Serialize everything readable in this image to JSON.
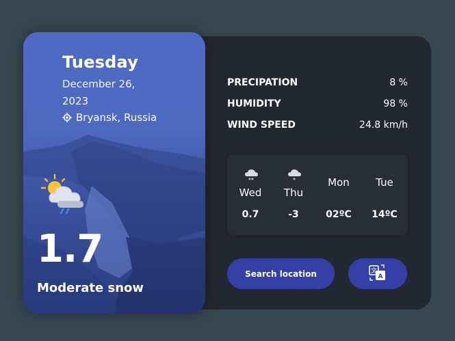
{
  "card": {
    "day": "Tuesday",
    "date": "December 26, 2023",
    "location": "Bryansk, Russia",
    "temperature": "1.7",
    "condition": "Moderate snow",
    "weather_icon": "sun-cloud-rain-icon"
  },
  "stats": [
    {
      "label": "PRECIPATION",
      "value": "8 %"
    },
    {
      "label": "HUMIDITY",
      "value": "98 %"
    },
    {
      "label": "WIND SPEED",
      "value": "24.8 km/h"
    }
  ],
  "forecast": [
    {
      "day": "Wed",
      "temp": "0.7",
      "icon": "snow-cloud-icon"
    },
    {
      "day": "Thu",
      "temp": "-3",
      "icon": "snow-cloud-icon"
    },
    {
      "day": "Mon",
      "temp": "02ºC",
      "icon": ""
    },
    {
      "day": "Tue",
      "temp": "14ºC",
      "icon": ""
    }
  ],
  "buttons": {
    "search": "Search location",
    "language_icon": "translate-icon"
  },
  "colors": {
    "background": "#37474f",
    "panel": "#222831",
    "accent": "#3540a6"
  }
}
